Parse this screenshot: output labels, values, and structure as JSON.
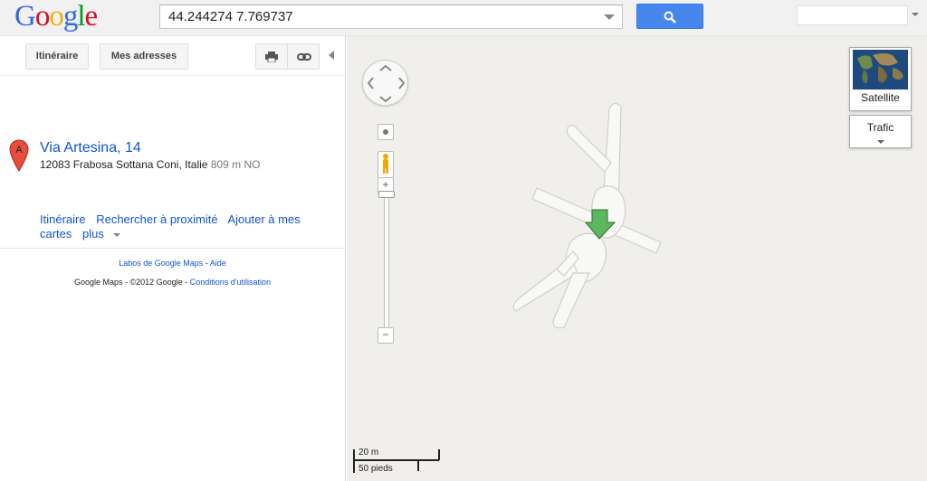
{
  "header": {
    "logo_text": "Google",
    "search_value": "44.244274 7.769737"
  },
  "toolbar": {
    "itinerary_label": "Itinéraire",
    "my_places_label": "Mes adresses"
  },
  "result": {
    "marker_letter": "A",
    "title": "Via Artesina, 14",
    "address": "12083 Frabosa Sottana Coni, Italie",
    "distance": "809 m NO",
    "links": {
      "itinerary": "Itinéraire",
      "search_nearby": "Rechercher à proximité",
      "add_to_maps": "Ajouter à mes cartes",
      "more": "plus"
    }
  },
  "footer": {
    "labs": "Labos de Google Maps",
    "separator": " - ",
    "help": "Aide",
    "copyright": "Google Maps - ©2012 Google - ",
    "terms": "Conditions d'utilisation"
  },
  "map": {
    "satellite_label": "Satellite",
    "traffic_label": "Trafic",
    "scale_metric": "20 m",
    "scale_imperial": "50 pieds",
    "zoom_in": "+",
    "zoom_out": "−"
  },
  "colors": {
    "link": "#1155cc",
    "search_button": "#4787ed",
    "map_bg": "#f0efeb",
    "marker_red": "#e74c3c",
    "arrow_green": "#5cb85c"
  },
  "icons": {
    "search": "magnifier-icon",
    "print": "printer-icon",
    "link": "chain-link-icon",
    "marker": "map-pin-icon",
    "pegman": "pegman-icon"
  }
}
